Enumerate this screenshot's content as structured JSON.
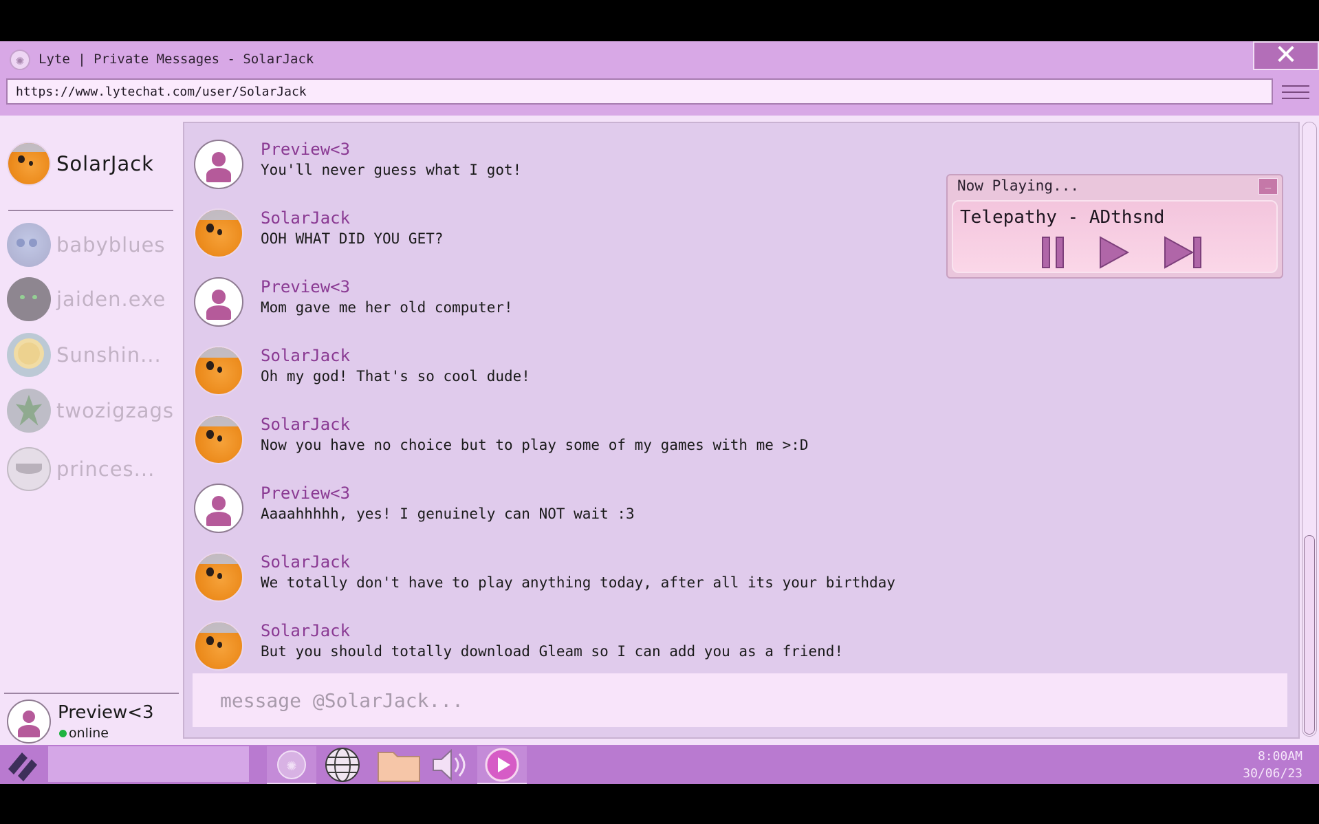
{
  "window": {
    "title": "Lyte | Private Messages - SolarJack",
    "close_label": "✕",
    "url": "https://www.lytechat.com/user/SolarJack"
  },
  "sidebar": {
    "contacts": [
      {
        "name": "SolarJack",
        "avatar": "orange-fish-avatar",
        "active": true
      },
      {
        "name": "babyblues",
        "avatar": "blue-eyed-character-avatar"
      },
      {
        "name": "jaiden.exe",
        "avatar": "dark-robot-avatar"
      },
      {
        "name": "Sunshin...",
        "avatar": "sunflower-avatar"
      },
      {
        "name": "twozigzags",
        "avatar": "leaf-avatar"
      },
      {
        "name": "princes...",
        "avatar": "gray-disc-avatar"
      }
    ],
    "profile": {
      "name": "Preview<3",
      "status": "online",
      "status_color": "#1fb341"
    }
  },
  "chat": {
    "messages": [
      {
        "author": "Preview<3",
        "text": "You'll never guess what I got!",
        "avatar": "person-avatar"
      },
      {
        "author": "SolarJack",
        "text": "OOH WHAT DID YOU GET?",
        "avatar": "orange-fish-avatar"
      },
      {
        "author": "Preview<3",
        "text": "Mom gave me her old computer!",
        "avatar": "person-avatar"
      },
      {
        "author": "SolarJack",
        "text": "Oh my god! That's so cool dude!",
        "avatar": "orange-fish-avatar"
      },
      {
        "author": "SolarJack",
        "text": "Now you have no choice but to play some of my games with me >:D",
        "avatar": "orange-fish-avatar"
      },
      {
        "author": "Preview<3",
        "text": "Aaaahhhhh, yes! I genuinely can NOT wait :3",
        "avatar": "person-avatar"
      },
      {
        "author": "SolarJack",
        "text": "We totally don't have to play anything today, after all its your birthday",
        "avatar": "orange-fish-avatar"
      },
      {
        "author": "SolarJack",
        "text": "But you should totally download Gleam so I can add you as a friend!",
        "avatar": "orange-fish-avatar"
      }
    ],
    "composer_placeholder": "message @SolarJack..."
  },
  "player": {
    "title": "Now Playing...",
    "track": "Telepathy - ADthsnd",
    "minimize_label": "_",
    "controls": [
      "pause-icon",
      "play-icon",
      "skip-next-icon"
    ]
  },
  "taskbar": {
    "icons": [
      "lyte-app-icon",
      "globe-icon",
      "folder-icon",
      "speaker-icon",
      "media-player-icon"
    ],
    "time": "8:00AM",
    "date": "30/06/23"
  },
  "colors": {
    "accent": "#b97ad0",
    "author": "#8a3a93",
    "chat_bg": "#e0cbec",
    "titlebar": "#d8a8e6"
  }
}
